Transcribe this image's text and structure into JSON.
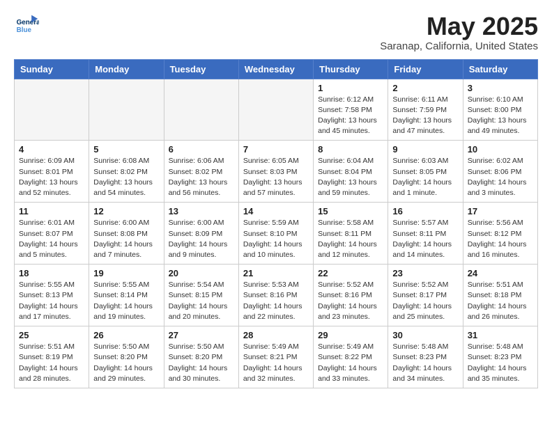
{
  "header": {
    "logo_line1": "General",
    "logo_line2": "Blue",
    "month_title": "May 2025",
    "location": "Saranap, California, United States"
  },
  "weekdays": [
    "Sunday",
    "Monday",
    "Tuesday",
    "Wednesday",
    "Thursday",
    "Friday",
    "Saturday"
  ],
  "weeks": [
    [
      {
        "day": "",
        "info": ""
      },
      {
        "day": "",
        "info": ""
      },
      {
        "day": "",
        "info": ""
      },
      {
        "day": "",
        "info": ""
      },
      {
        "day": "1",
        "info": "Sunrise: 6:12 AM\nSunset: 7:58 PM\nDaylight: 13 hours\nand 45 minutes."
      },
      {
        "day": "2",
        "info": "Sunrise: 6:11 AM\nSunset: 7:59 PM\nDaylight: 13 hours\nand 47 minutes."
      },
      {
        "day": "3",
        "info": "Sunrise: 6:10 AM\nSunset: 8:00 PM\nDaylight: 13 hours\nand 49 minutes."
      }
    ],
    [
      {
        "day": "4",
        "info": "Sunrise: 6:09 AM\nSunset: 8:01 PM\nDaylight: 13 hours\nand 52 minutes."
      },
      {
        "day": "5",
        "info": "Sunrise: 6:08 AM\nSunset: 8:02 PM\nDaylight: 13 hours\nand 54 minutes."
      },
      {
        "day": "6",
        "info": "Sunrise: 6:06 AM\nSunset: 8:02 PM\nDaylight: 13 hours\nand 56 minutes."
      },
      {
        "day": "7",
        "info": "Sunrise: 6:05 AM\nSunset: 8:03 PM\nDaylight: 13 hours\nand 57 minutes."
      },
      {
        "day": "8",
        "info": "Sunrise: 6:04 AM\nSunset: 8:04 PM\nDaylight: 13 hours\nand 59 minutes."
      },
      {
        "day": "9",
        "info": "Sunrise: 6:03 AM\nSunset: 8:05 PM\nDaylight: 14 hours\nand 1 minute."
      },
      {
        "day": "10",
        "info": "Sunrise: 6:02 AM\nSunset: 8:06 PM\nDaylight: 14 hours\nand 3 minutes."
      }
    ],
    [
      {
        "day": "11",
        "info": "Sunrise: 6:01 AM\nSunset: 8:07 PM\nDaylight: 14 hours\nand 5 minutes."
      },
      {
        "day": "12",
        "info": "Sunrise: 6:00 AM\nSunset: 8:08 PM\nDaylight: 14 hours\nand 7 minutes."
      },
      {
        "day": "13",
        "info": "Sunrise: 6:00 AM\nSunset: 8:09 PM\nDaylight: 14 hours\nand 9 minutes."
      },
      {
        "day": "14",
        "info": "Sunrise: 5:59 AM\nSunset: 8:10 PM\nDaylight: 14 hours\nand 10 minutes."
      },
      {
        "day": "15",
        "info": "Sunrise: 5:58 AM\nSunset: 8:11 PM\nDaylight: 14 hours\nand 12 minutes."
      },
      {
        "day": "16",
        "info": "Sunrise: 5:57 AM\nSunset: 8:11 PM\nDaylight: 14 hours\nand 14 minutes."
      },
      {
        "day": "17",
        "info": "Sunrise: 5:56 AM\nSunset: 8:12 PM\nDaylight: 14 hours\nand 16 minutes."
      }
    ],
    [
      {
        "day": "18",
        "info": "Sunrise: 5:55 AM\nSunset: 8:13 PM\nDaylight: 14 hours\nand 17 minutes."
      },
      {
        "day": "19",
        "info": "Sunrise: 5:55 AM\nSunset: 8:14 PM\nDaylight: 14 hours\nand 19 minutes."
      },
      {
        "day": "20",
        "info": "Sunrise: 5:54 AM\nSunset: 8:15 PM\nDaylight: 14 hours\nand 20 minutes."
      },
      {
        "day": "21",
        "info": "Sunrise: 5:53 AM\nSunset: 8:16 PM\nDaylight: 14 hours\nand 22 minutes."
      },
      {
        "day": "22",
        "info": "Sunrise: 5:52 AM\nSunset: 8:16 PM\nDaylight: 14 hours\nand 23 minutes."
      },
      {
        "day": "23",
        "info": "Sunrise: 5:52 AM\nSunset: 8:17 PM\nDaylight: 14 hours\nand 25 minutes."
      },
      {
        "day": "24",
        "info": "Sunrise: 5:51 AM\nSunset: 8:18 PM\nDaylight: 14 hours\nand 26 minutes."
      }
    ],
    [
      {
        "day": "25",
        "info": "Sunrise: 5:51 AM\nSunset: 8:19 PM\nDaylight: 14 hours\nand 28 minutes."
      },
      {
        "day": "26",
        "info": "Sunrise: 5:50 AM\nSunset: 8:20 PM\nDaylight: 14 hours\nand 29 minutes."
      },
      {
        "day": "27",
        "info": "Sunrise: 5:50 AM\nSunset: 8:20 PM\nDaylight: 14 hours\nand 30 minutes."
      },
      {
        "day": "28",
        "info": "Sunrise: 5:49 AM\nSunset: 8:21 PM\nDaylight: 14 hours\nand 32 minutes."
      },
      {
        "day": "29",
        "info": "Sunrise: 5:49 AM\nSunset: 8:22 PM\nDaylight: 14 hours\nand 33 minutes."
      },
      {
        "day": "30",
        "info": "Sunrise: 5:48 AM\nSunset: 8:23 PM\nDaylight: 14 hours\nand 34 minutes."
      },
      {
        "day": "31",
        "info": "Sunrise: 5:48 AM\nSunset: 8:23 PM\nDaylight: 14 hours\nand 35 minutes."
      }
    ]
  ]
}
